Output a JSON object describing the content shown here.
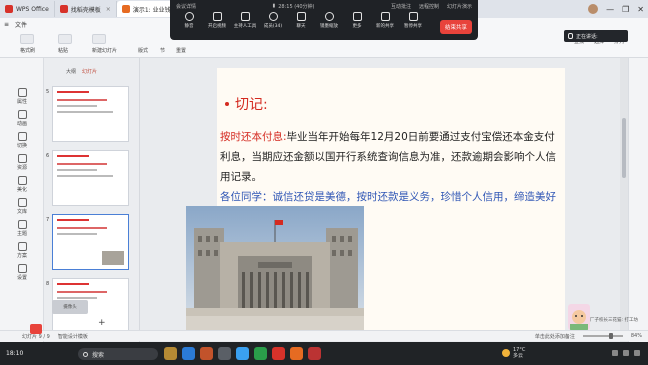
{
  "tabs": [
    {
      "label": "WPS Office",
      "color": "#d7322a"
    },
    {
      "label": "找稻壳模板",
      "color": "#d7322a"
    },
    {
      "label": "演示1: 业业钱公司管",
      "color": "#e66b22"
    }
  ],
  "meeting": {
    "title": "会议详情",
    "timer": "28:15 (40分钟)",
    "right_items": [
      "互动批注",
      "远程控制",
      "幻灯片演示"
    ],
    "tools": [
      "静音",
      "开启视频",
      "主持人工具",
      "成员(34)",
      "聊天",
      "镜墨缩放",
      "更多",
      "新的共享",
      "暂停共享"
    ],
    "end_label": "结束共享"
  },
  "menubar": [
    "文件",
    "开始"
  ],
  "ribbon": {
    "groups": [
      "格式刷",
      "粘贴",
      "新建幻灯片",
      "版式",
      "节",
      "重置"
    ],
    "right_tools": [
      "查找",
      "选择",
      "排列"
    ]
  },
  "speaking": "正在讲话:",
  "side_items": [
    "属性",
    "动画",
    "切换",
    "资源",
    "美化",
    "文库",
    "主题",
    "方案",
    "设置"
  ],
  "thumbs": {
    "header": "大纲",
    "header2": "幻灯片",
    "numbers": [
      "5",
      "6",
      "7",
      "8"
    ],
    "camera": "摄像头"
  },
  "slide": {
    "title": "切记:",
    "p1_red": "按时还本付息:",
    "p1": "毕业当年开始每年12月20日前要通过支付宝偿还本金支付利息，当期应还金额以国开行系统查询信息为准，还款逾期会影响个人信用记录。",
    "p2": "各位同学：诚信还贷是美德，按时还款是义务，珍惜个人信用，缔造美好人生!"
  },
  "statusbar": {
    "page": "幻灯片 9 / 9",
    "ai": "智能设计模板",
    "note": "单击此处添加备注",
    "zoom": "84%"
  },
  "cartoon_label": "厂子校长三花猫: 打工坊",
  "taskbar": {
    "time": "18:10",
    "search": "搜索",
    "weather_temp": "17°C",
    "weather_desc": "多云"
  },
  "colors": {
    "accent_red": "#d42a20",
    "text_blue": "#2f56b5",
    "meeting_bg": "#1f2226",
    "end_button": "#e8433b"
  }
}
